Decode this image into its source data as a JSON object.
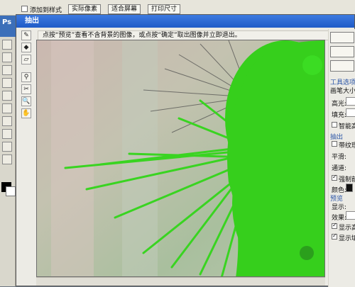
{
  "optbar": {
    "add_to_history_label": "添加到样式",
    "btn_realtime": "实际像素",
    "btn_fit": "适合屏幕",
    "btn_print": "打印尺寸"
  },
  "app": {
    "logo": "Ps"
  },
  "dialog": {
    "title": "抽出",
    "hint": "点按“预览”查看不含背景的图像，或点按“确定”取出图像并立即退出。",
    "tool_icons": [
      "edge-highlighter-icon",
      "fill-icon",
      "eraser-icon",
      "cleanup-icon",
      "edge-touchup-icon",
      "zoom-icon",
      "hand-icon"
    ]
  },
  "panel": {
    "tool_options_title": "工具选项",
    "brush_size_label": "画笔大小",
    "highlight_label": "高光:",
    "fill_label": "填充:",
    "smart_highlight_label": "智能高光",
    "extraction_title": "抽出",
    "textured_label": "带纹理图",
    "smooth_label": "平滑:",
    "channel_label": "通道:",
    "force_fg_label": "强制前景",
    "color_label": "颜色:",
    "preview_title": "预览",
    "show_label": "显示:",
    "effect_label": "效果:",
    "show_highlight_label": "显示高光",
    "show_fill_label": "显示填充"
  },
  "colors": {
    "title_blue": "#1f5bc7",
    "highlight_green": "#37d21e",
    "panel_bg": "#ecebe5"
  }
}
